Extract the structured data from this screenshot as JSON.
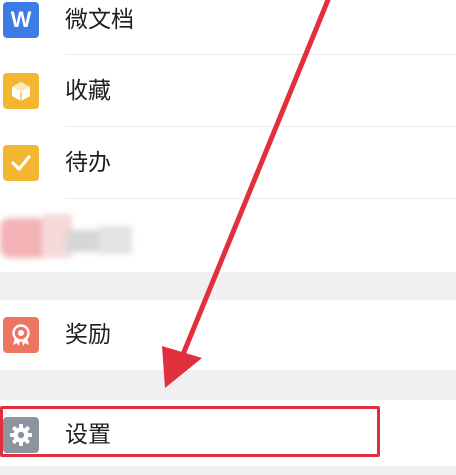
{
  "menu": {
    "items": [
      {
        "label": "微文档",
        "icon": "word-doc-icon",
        "color": "#3d7be6",
        "icon_text": "W"
      },
      {
        "label": "收藏",
        "icon": "favorites-cube-icon",
        "color": "#f2b631"
      },
      {
        "label": "待办",
        "icon": "todo-check-icon",
        "color": "#f2b631"
      },
      {
        "label": "奖励",
        "icon": "reward-medal-icon",
        "color": "#ef7563"
      },
      {
        "label": "设置",
        "icon": "settings-gear-icon",
        "color": "#8c949f"
      }
    ]
  },
  "annotation": {
    "arrow_color": "#e0303c",
    "highlight_color": "#e0303c"
  }
}
